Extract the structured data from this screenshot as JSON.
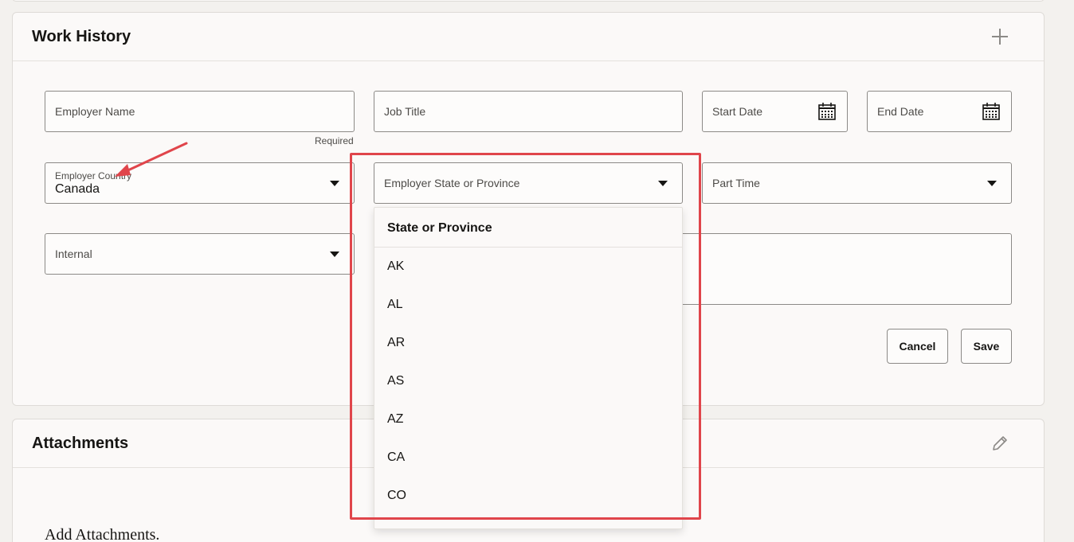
{
  "work_history": {
    "title": "Work History",
    "fields": {
      "employer_name": "Employer Name",
      "employer_name_hint": "Required",
      "job_title": "Job Title",
      "start_date": "Start Date",
      "end_date": "End Date",
      "employer_country_label": "Employer Country",
      "employer_country_value": "Canada",
      "employer_state": "Employer State or Province",
      "part_time": "Part Time",
      "internal": "Internal"
    },
    "buttons": {
      "cancel": "Cancel",
      "save": "Save"
    },
    "state_dropdown": {
      "header": "State or Province",
      "options": [
        "AK",
        "AL",
        "AR",
        "AS",
        "AZ",
        "CA",
        "CO"
      ]
    }
  },
  "attachments": {
    "title": "Attachments",
    "add_text": "Add Attachments."
  },
  "annotation": {
    "color": "#e0454b"
  }
}
